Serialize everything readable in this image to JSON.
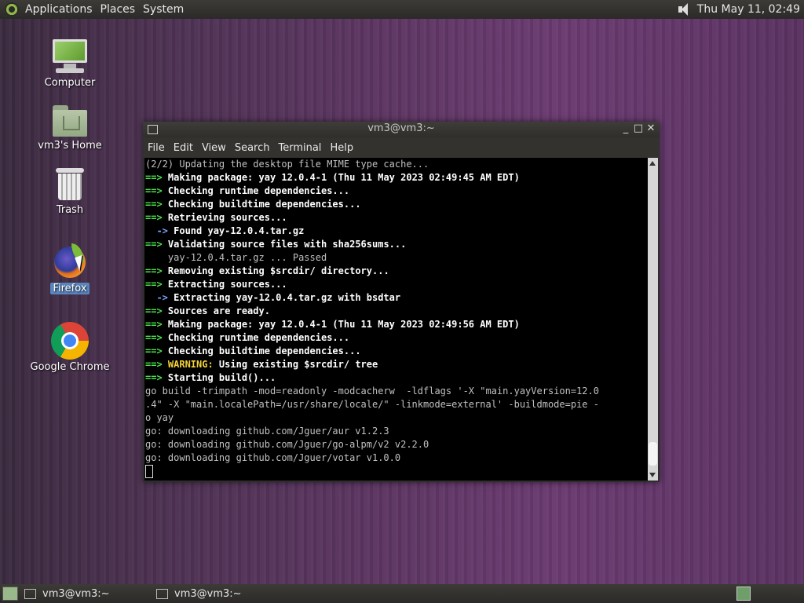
{
  "top_panel": {
    "menus": [
      "Applications",
      "Places",
      "System"
    ],
    "clock": "Thu May 11, 02:49"
  },
  "desktop_icons": [
    {
      "label": "Computer",
      "icon": "computer-icon"
    },
    {
      "label": "vm3's Home",
      "icon": "home-folder-icon"
    },
    {
      "label": "Trash",
      "icon": "trash-icon"
    },
    {
      "label": "Firefox",
      "icon": "firefox-icon"
    },
    {
      "label": "Google Chrome",
      "icon": "chrome-icon"
    }
  ],
  "terminal": {
    "title": "vm3@vm3:~",
    "menus": [
      "File",
      "Edit",
      "View",
      "Search",
      "Terminal",
      "Help"
    ],
    "lines": [
      {
        "segments": [
          {
            "t": "(2/2) Updating the desktop file MIME type cache...",
            "c": "plain"
          }
        ]
      },
      {
        "segments": [
          {
            "t": "==> ",
            "c": "arrow"
          },
          {
            "t": "Making package: yay 12.0.4-1 (Thu 11 May 2023 02:49:45 AM EDT)",
            "c": "bold"
          }
        ]
      },
      {
        "segments": [
          {
            "t": "==> ",
            "c": "arrow"
          },
          {
            "t": "Checking runtime dependencies...",
            "c": "bold"
          }
        ]
      },
      {
        "segments": [
          {
            "t": "==> ",
            "c": "arrow"
          },
          {
            "t": "Checking buildtime dependencies...",
            "c": "bold"
          }
        ]
      },
      {
        "segments": [
          {
            "t": "==> ",
            "c": "arrow"
          },
          {
            "t": "Retrieving sources...",
            "c": "bold"
          }
        ]
      },
      {
        "segments": [
          {
            "t": "  -> ",
            "c": "sub"
          },
          {
            "t": "Found yay-12.0.4.tar.gz",
            "c": "bold"
          }
        ]
      },
      {
        "segments": [
          {
            "t": "==> ",
            "c": "arrow"
          },
          {
            "t": "Validating source files with sha256sums...",
            "c": "bold"
          }
        ]
      },
      {
        "segments": [
          {
            "t": "    yay-12.0.4.tar.gz ... Passed",
            "c": "plain"
          }
        ]
      },
      {
        "segments": [
          {
            "t": "==> ",
            "c": "arrow"
          },
          {
            "t": "Removing existing $srcdir/ directory...",
            "c": "bold"
          }
        ]
      },
      {
        "segments": [
          {
            "t": "==> ",
            "c": "arrow"
          },
          {
            "t": "Extracting sources...",
            "c": "bold"
          }
        ]
      },
      {
        "segments": [
          {
            "t": "  -> ",
            "c": "sub"
          },
          {
            "t": "Extracting yay-12.0.4.tar.gz with bsdtar",
            "c": "bold"
          }
        ]
      },
      {
        "segments": [
          {
            "t": "==> ",
            "c": "arrow"
          },
          {
            "t": "Sources are ready.",
            "c": "bold"
          }
        ]
      },
      {
        "segments": [
          {
            "t": "==> ",
            "c": "arrow"
          },
          {
            "t": "Making package: yay 12.0.4-1 (Thu 11 May 2023 02:49:56 AM EDT)",
            "c": "bold"
          }
        ]
      },
      {
        "segments": [
          {
            "t": "==> ",
            "c": "arrow"
          },
          {
            "t": "Checking runtime dependencies...",
            "c": "bold"
          }
        ]
      },
      {
        "segments": [
          {
            "t": "==> ",
            "c": "arrow"
          },
          {
            "t": "Checking buildtime dependencies...",
            "c": "bold"
          }
        ]
      },
      {
        "segments": [
          {
            "t": "==> ",
            "c": "arrow"
          },
          {
            "t": "WARNING:",
            "c": "warn"
          },
          {
            "t": " Using existing $srcdir/ tree",
            "c": "bold"
          }
        ]
      },
      {
        "segments": [
          {
            "t": "==> ",
            "c": "arrow"
          },
          {
            "t": "Starting build()...",
            "c": "bold"
          }
        ]
      },
      {
        "segments": [
          {
            "t": "go build -trimpath -mod=readonly -modcacherw  -ldflags '-X \"main.yayVersion=12.0",
            "c": "plain"
          }
        ]
      },
      {
        "segments": [
          {
            "t": ".4\" -X \"main.localePath=/usr/share/locale/\" -linkmode=external' -buildmode=pie -",
            "c": "plain"
          }
        ]
      },
      {
        "segments": [
          {
            "t": "o yay",
            "c": "plain"
          }
        ]
      },
      {
        "segments": [
          {
            "t": "go: downloading github.com/Jguer/aur v1.2.3",
            "c": "plain"
          }
        ]
      },
      {
        "segments": [
          {
            "t": "go: downloading github.com/Jguer/go-alpm/v2 v2.2.0",
            "c": "plain"
          }
        ]
      },
      {
        "segments": [
          {
            "t": "go: downloading github.com/Jguer/votar v1.0.0",
            "c": "plain"
          }
        ]
      }
    ]
  },
  "bottom_panel": {
    "tasks": [
      "vm3@vm3:~",
      "vm3@vm3:~"
    ]
  }
}
